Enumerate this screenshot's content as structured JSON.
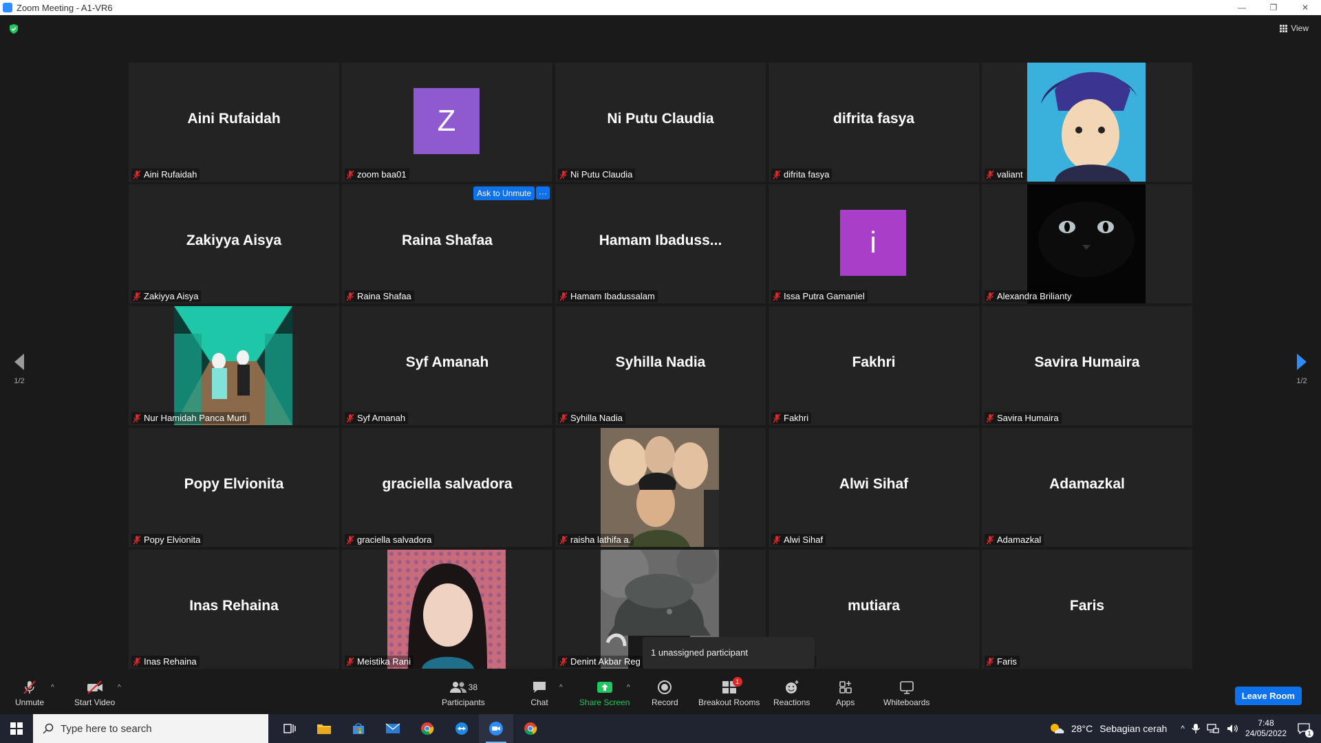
{
  "window": {
    "title": "Zoom Meeting - A1-VR6",
    "controls": [
      "—",
      "❐",
      "✕"
    ]
  },
  "top": {
    "view_label": "View"
  },
  "pager": {
    "left_label": "1/2",
    "right_label": "1/2"
  },
  "tiles": [
    {
      "name": "Aini Rufaidah",
      "display": "Aini Rufaidah",
      "type": "name"
    },
    {
      "name": "zoom baa01",
      "display": "Z",
      "type": "avatar",
      "color": "#8f5acf"
    },
    {
      "name": "Ni Putu Claudia",
      "display": "Ni Putu Claudia",
      "type": "name"
    },
    {
      "name": "difrita fasya",
      "display": "difrita fasya",
      "type": "name"
    },
    {
      "name": "valiant",
      "display": "",
      "type": "photo",
      "photo": "anime"
    },
    {
      "name": "Zakiyya Aisya",
      "display": "Zakiyya Aisya",
      "type": "name"
    },
    {
      "name": "Raina Shafaa",
      "display": "Raina Shafaa",
      "type": "name"
    },
    {
      "name": "Hamam Ibadussalam",
      "display": "Hamam  Ibaduss...",
      "type": "name"
    },
    {
      "name": "Issa Putra Gamaniel",
      "display": "i",
      "type": "avatar",
      "color": "#a93ec9"
    },
    {
      "name": "Alexandra Brilianty",
      "display": "",
      "type": "photo",
      "photo": "cat"
    },
    {
      "name": "Nur Hamidah Panca Murti",
      "display": "",
      "type": "photo",
      "photo": "bridge"
    },
    {
      "name": "Syf Amanah",
      "display": "Syf Amanah",
      "type": "name"
    },
    {
      "name": "Syhilla Nadia",
      "display": "Syhilla Nadia",
      "type": "name"
    },
    {
      "name": "Fakhri",
      "display": "Fakhri",
      "type": "name"
    },
    {
      "name": "Savira Humaira",
      "display": "Savira Humaira",
      "type": "name"
    },
    {
      "name": "Popy Elvionita",
      "display": "Popy Elvionita",
      "type": "name"
    },
    {
      "name": "graciella salvadora",
      "display": "graciella salvadora",
      "type": "name"
    },
    {
      "name": "raisha lathifa a.",
      "display": "",
      "type": "photo",
      "photo": "group"
    },
    {
      "name": "Alwi Sihaf",
      "display": "Alwi Sihaf",
      "type": "name"
    },
    {
      "name": "Adamazkal",
      "display": "Adamazkal",
      "type": "name"
    },
    {
      "name": "Inas Rehaina",
      "display": "Inas Rehaina",
      "type": "name"
    },
    {
      "name": "Meistika Rani",
      "display": "",
      "type": "photo",
      "photo": "selfie"
    },
    {
      "name": "Denint Akbar Reg",
      "display": "",
      "type": "photo",
      "photo": "helmet"
    },
    {
      "name": "mutiara",
      "display": "mutiara",
      "type": "name"
    },
    {
      "name": "Faris",
      "display": "Faris",
      "type": "name"
    }
  ],
  "hover": {
    "ask_unmute": "Ask to Unmute",
    "more": "···"
  },
  "tooltip": "1 unassigned participant",
  "toolbar": {
    "unmute": "Unmute",
    "start_video": "Start Video",
    "participants": "Participants",
    "participants_count": "38",
    "chat": "Chat",
    "share_screen": "Share Screen",
    "record": "Record",
    "breakout_rooms": "Breakout Rooms",
    "breakout_badge": "1",
    "reactions": "Reactions",
    "apps": "Apps",
    "whiteboards": "Whiteboards",
    "leave": "Leave Room"
  },
  "taskbar": {
    "search_placeholder": "Type here to search",
    "weather_temp": "28°C",
    "weather_text": "Sebagian cerah",
    "time": "7:48",
    "date": "24/05/2022",
    "notification_count": "1"
  },
  "colors": {
    "accent": "#0e72ed",
    "share_green": "#22c55e",
    "mic_off_red": "#e02828",
    "tile_bg": "#232323"
  }
}
